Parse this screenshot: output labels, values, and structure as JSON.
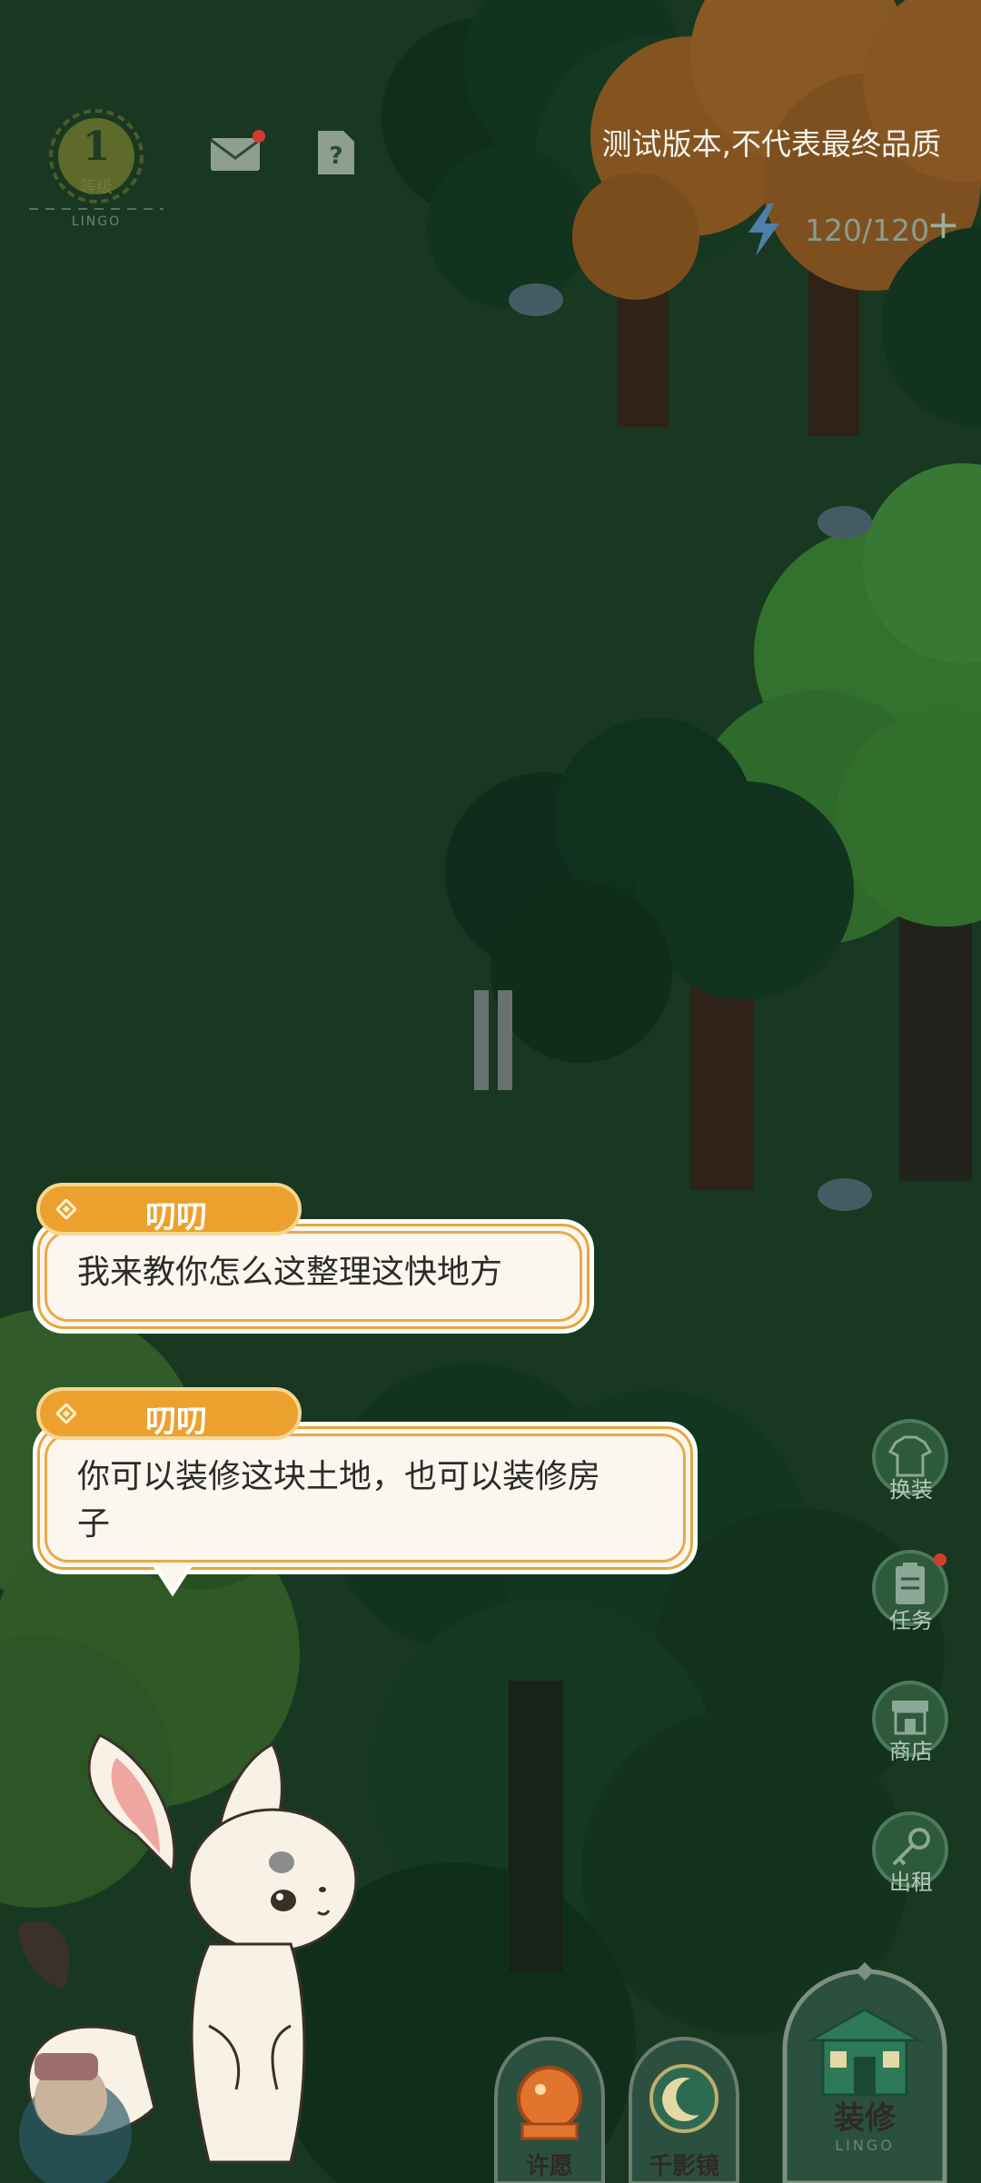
{
  "hud": {
    "level_number": "1",
    "level_label": "等级",
    "level_sub": "LINGO",
    "test_notice": "测试版本,不代表最终品质",
    "energy": "120/120",
    "energy_add": "+"
  },
  "dialogs": [
    {
      "speaker": "叨叨",
      "text": "我来教你怎么这整理这快地方"
    },
    {
      "speaker": "叨叨",
      "text_line1": "你可以装修这块土地，也可以装修房",
      "text_line2": "子"
    }
  ],
  "side_menu": [
    {
      "label": "换装",
      "icon": "shirt-icon",
      "badge": false
    },
    {
      "label": "任务",
      "icon": "clipboard-icon",
      "badge": true
    },
    {
      "label": "商店",
      "icon": "shop-icon",
      "badge": false
    },
    {
      "label": "出租",
      "icon": "key-icon",
      "badge": false
    }
  ],
  "bottom_menu": [
    {
      "label": "许愿",
      "icon": "crystal-ball-icon"
    },
    {
      "label": "千影镜",
      "icon": "moon-mirror-icon"
    },
    {
      "label": "装修",
      "icon": "house-icon",
      "sub": "LINGO"
    }
  ],
  "colors": {
    "accent_orange": "#eca12e",
    "dialog_bg": "#fbf7ee",
    "forest_green": "#1f4a2a",
    "badge_red": "#d33b2e"
  }
}
